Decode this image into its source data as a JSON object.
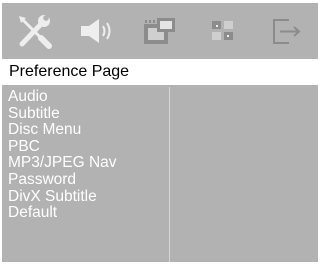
{
  "header": {
    "title": "Preference Page"
  },
  "toolbar": {
    "icons": [
      "tools-icon",
      "speaker-icon",
      "video-icon",
      "preference-icon",
      "exit-icon"
    ]
  },
  "menu": {
    "items": [
      "Audio",
      "Subtitle",
      "Disc Menu",
      "PBC",
      "MP3/JPEG Nav",
      "Password",
      "DivX Subtitle",
      "Default"
    ]
  },
  "colors": {
    "panel": "#b2b2b2",
    "icon_light": "#eeeeee",
    "icon_dark": "#8c8c8c",
    "header_bg": "#ffffff",
    "menu_text": "#ffffff"
  }
}
